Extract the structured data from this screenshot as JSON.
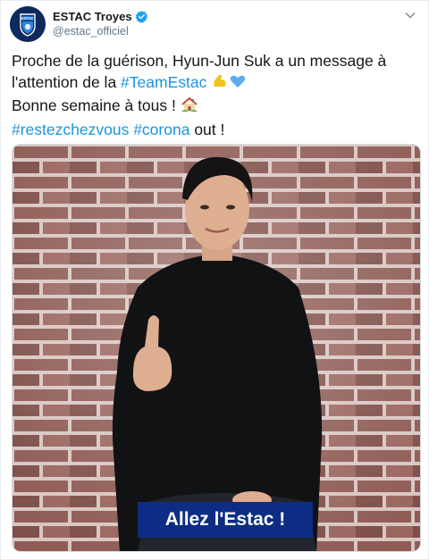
{
  "account": {
    "display_name": "ESTAC Troyes",
    "handle": "@estac_officiel",
    "verified": true,
    "avatar_icon": "estac-crest-logo"
  },
  "tweet": {
    "line1": "Proche de la guérison, Hyun-Jun Suk a un message à",
    "line2_prefix": "l'attention de la ",
    "line2_hashtag": "#TeamEstac",
    "line3": "Bonne semaine à tous ! ",
    "line4_hashtag1": "#restezchezvous",
    "line4_hashtag2": "#corona",
    "line4_suffix": " out !"
  },
  "media": {
    "type": "video",
    "caption": "Allez l'Estac !"
  },
  "colors": {
    "hashtag": "#1b95e0",
    "verified": "#1da1f2",
    "caption_bg": "#0c2d83",
    "brand_navy": "#0e2a5c"
  },
  "icons": {
    "caret": "chevron-down-icon",
    "verified": "verified-badge-icon",
    "emoji1": "flexed-biceps-emoji",
    "emoji2": "blue-heart-emoji",
    "emoji3": "house-emoji"
  }
}
